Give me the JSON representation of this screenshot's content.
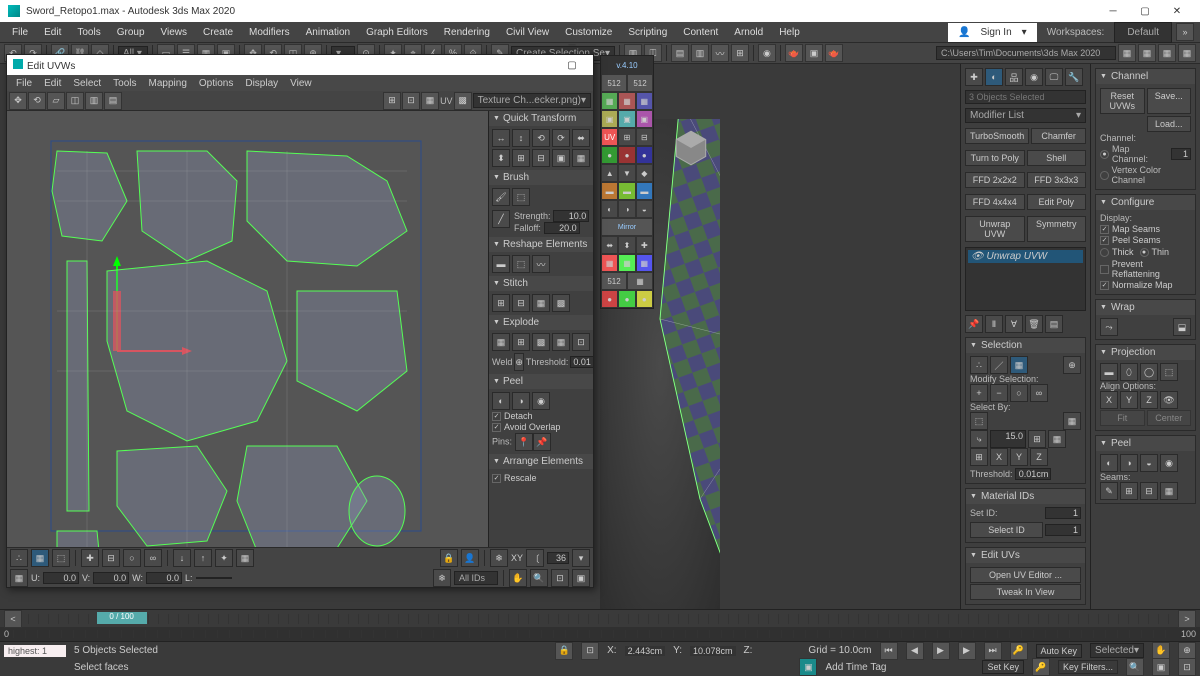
{
  "app": {
    "title": "Sword_Retopo1.max - Autodesk 3ds Max 2020",
    "signin": "Sign In",
    "workspaces_label": "Workspaces:",
    "workspace": "Default"
  },
  "main_menu": [
    "File",
    "Edit",
    "Tools",
    "Group",
    "Views",
    "Create",
    "Modifiers",
    "Animation",
    "Graph Editors",
    "Rendering",
    "Civil View",
    "Customize",
    "Scripting",
    "Content",
    "Arnold",
    "Help"
  ],
  "toolbar2": {
    "selection_set": "Create Selection Se",
    "path": "C:\\Users\\Tim\\Documents\\3ds Max 2020"
  },
  "uvw": {
    "title": "Edit UVWs",
    "menu": [
      "File",
      "Edit",
      "Select",
      "Tools",
      "Mapping",
      "Options",
      "Display",
      "View"
    ],
    "checker": "Texture Ch...ecker.png)",
    "uv_label": "UV",
    "side": {
      "quick_transform": "Quick Transform",
      "brush": "Brush",
      "strength": "Strength:",
      "strength_v": "10.0",
      "falloff": "Falloff:",
      "falloff_v": "20.0",
      "reshape": "Reshape Elements",
      "stitch": "Stitch",
      "explode": "Explode",
      "weld": "Weld",
      "threshold": "Threshold:",
      "threshold_v": "0.01",
      "peel": "Peel",
      "detach": "Detach",
      "avoid_overlap": "Avoid Overlap",
      "pins": "Pins:",
      "arrange": "Arrange Elements",
      "rescale": "Rescale"
    },
    "coords": {
      "u_l": "U:",
      "u": "0.0",
      "v_l": "V:",
      "v": "0.0",
      "w_l": "W:",
      "w": "0.0",
      "l_l": "L:",
      "xy": "XY",
      "ang": "36",
      "allids": "All IDs"
    }
  },
  "float_ver": "v.4.10",
  "float_512": "512",
  "modify": {
    "objects_selected": "3 Objects Selected",
    "modlist": "Modifier List",
    "btns": [
      [
        "TurboSmooth",
        "Chamfer"
      ],
      [
        "Turn to Poly",
        "Shell"
      ],
      [
        "FFD 2x2x2",
        "FFD 3x3x3"
      ],
      [
        "FFD 4x4x4",
        "Edit Poly"
      ],
      [
        "Unwrap UVW",
        "Symmetry"
      ]
    ],
    "stack": "Unwrap UVW",
    "sel": {
      "h": "Selection",
      "modify_sel": "Modify Selection:",
      "select_by": "Select By:",
      "val15": "15.0",
      "threshold": "Threshold:",
      "threshold_v": "0.01cm"
    },
    "matid": {
      "h": "Material IDs",
      "setid": "Set ID:",
      "setid_v": "1",
      "selectid": "Select ID",
      "selectid_v": "1"
    },
    "edituv": {
      "h": "Edit UVs",
      "open": "Open UV Editor ...",
      "tweak": "Tweak In View"
    }
  },
  "channel_panel": {
    "h": "Channel",
    "reset": "Reset UVWs",
    "save": "Save...",
    "load": "Load...",
    "channel_l": "Channel:",
    "map_channel": "Map Channel:",
    "map_v": "1",
    "vcc": "Vertex Color Channel"
  },
  "configure": {
    "h": "Configure",
    "display": "Display:",
    "map_seams": "Map Seams",
    "peel_seams": "Peel Seams",
    "thick": "Thick",
    "thin": "Thin",
    "prevent": "Prevent Reflattening",
    "normalize": "Normalize Map"
  },
  "wrap_p": {
    "h": "Wrap"
  },
  "projection": {
    "h": "Projection",
    "align": "Align Options:",
    "x": "X",
    "y": "Y",
    "z": "Z",
    "fit": "Fit",
    "center": "Center"
  },
  "peel_p": {
    "h": "Peel",
    "seams": "Seams:"
  },
  "timeline": {
    "frame": "0 / 100",
    "start": "0",
    "end": "100"
  },
  "status": {
    "sel": "5 Objects Selected",
    "prompt": "Select faces",
    "maxscript": "highest: 1",
    "x": "X:",
    "xv": "2.443cm",
    "y": "Y:",
    "yv": "10.078cm",
    "z": "Z:",
    "zv": "",
    "grid": "Grid = 10.0cm",
    "addtag": "Add Time Tag",
    "autokey": "Auto Key",
    "setkey": "Set Key",
    "selected": "Selected",
    "keyf": "Key Filters..."
  }
}
